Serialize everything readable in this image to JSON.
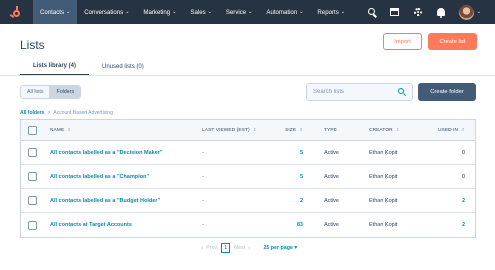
{
  "nav": {
    "items": [
      {
        "label": "Contacts",
        "active": true
      },
      {
        "label": "Conversations",
        "active": false
      },
      {
        "label": "Marketing",
        "active": false
      },
      {
        "label": "Sales",
        "active": false
      },
      {
        "label": "Service",
        "active": false
      },
      {
        "label": "Automation",
        "active": false
      },
      {
        "label": "Reports",
        "active": false
      }
    ],
    "caret": "⌄",
    "icons": [
      "search-icon",
      "marketplace-icon",
      "settings-gear-icon",
      "notifications-bell-icon"
    ],
    "avatar_caret": "⌄"
  },
  "header": {
    "title": "Lists",
    "import_label": "Import",
    "create_label": "Create list",
    "tabs": [
      {
        "label": "Lists library (4)",
        "active": true
      },
      {
        "label": "Unused lists (0)",
        "active": false
      }
    ]
  },
  "toolbar": {
    "all_lists": "All lists",
    "folders": "Folders",
    "search_placeholder": "Search lists",
    "create_folder": "Create folder"
  },
  "breadcrumb": {
    "root": "All folders",
    "sep": ">",
    "current": "Account Based Advertising"
  },
  "table": {
    "columns": {
      "name": "NAME",
      "viewed": "LAST VIEWED (EST)",
      "size": "SIZE",
      "type": "TYPE",
      "creator": "CREATOR",
      "used": "USED IN"
    },
    "sort_glyph": "⇕",
    "rows": [
      {
        "name": "All contacts labelled as a \"Decision Maker\"",
        "viewed": "-",
        "size": "5",
        "type": "Active",
        "creator": "Ethan Kopit",
        "used": "0",
        "used_link": false
      },
      {
        "name": "All contacts labelled as a \"Champion\"",
        "viewed": "-",
        "size": "5",
        "type": "Active",
        "creator": "Ethan Kopit",
        "used": "0",
        "used_link": false
      },
      {
        "name": "All contacts labelled as a \"Budget Holder\"",
        "viewed": "-",
        "size": "2",
        "type": "Active",
        "creator": "Ethan Kopit",
        "used": "2",
        "used_link": true
      },
      {
        "name": "All contacts at Target Accounts",
        "viewed": "-",
        "size": "83",
        "type": "Active",
        "creator": "Ethan Kopit",
        "used": "2",
        "used_link": true
      }
    ]
  },
  "pagination": {
    "prev": "Prev",
    "prev_glyph": "‹",
    "page": "1",
    "next": "Next",
    "next_glyph": "›",
    "per_page": "25 per page",
    "per_page_caret": "▾"
  },
  "colors": {
    "nav_bg": "#253342",
    "accent": "#ff7a59",
    "link": "#0091ae",
    "dark_button": "#425b76"
  }
}
